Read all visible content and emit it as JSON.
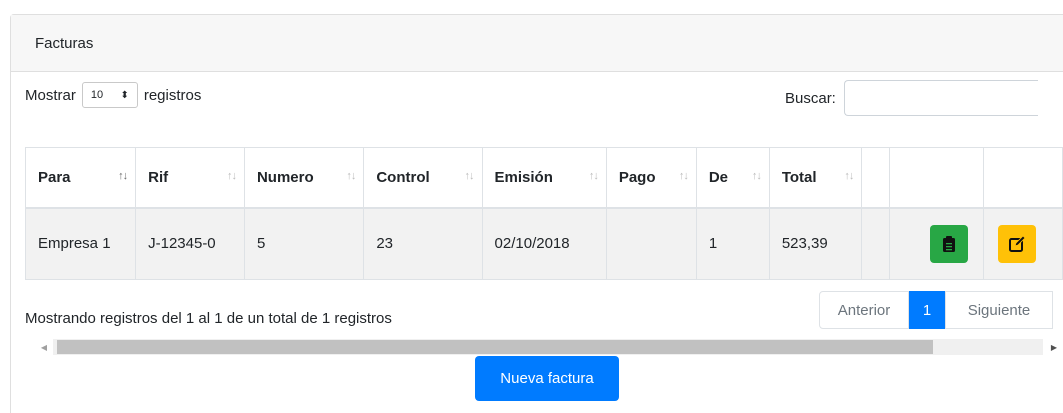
{
  "card": {
    "title": "Facturas"
  },
  "length": {
    "prefix": "Mostrar",
    "value": "10",
    "suffix": "registros"
  },
  "search": {
    "label": "Buscar:",
    "value": ""
  },
  "table": {
    "headers": [
      "Para",
      "Rif",
      "Numero",
      "Control",
      "Emisión",
      "Pago",
      "De",
      "Total",
      "",
      ""
    ],
    "rows": [
      {
        "para": "Empresa 1",
        "rif": "J-12345-0",
        "numero": "5",
        "control": "23",
        "emision": "02/10/2018",
        "pago": "",
        "de": "1",
        "total": "523,39"
      }
    ]
  },
  "info": "Mostrando registros del 1 al 1 de un total de 1 registros",
  "pagination": {
    "prev": "Anterior",
    "current": "1",
    "next": "Siguiente"
  },
  "new_button": "Nueva factura",
  "colors": {
    "primary": "#007bff",
    "success": "#28a745",
    "warning": "#ffc107"
  },
  "icons": {
    "view": "clipboard-icon",
    "edit": "edit-icon",
    "sort": "sort-arrows-icon"
  }
}
